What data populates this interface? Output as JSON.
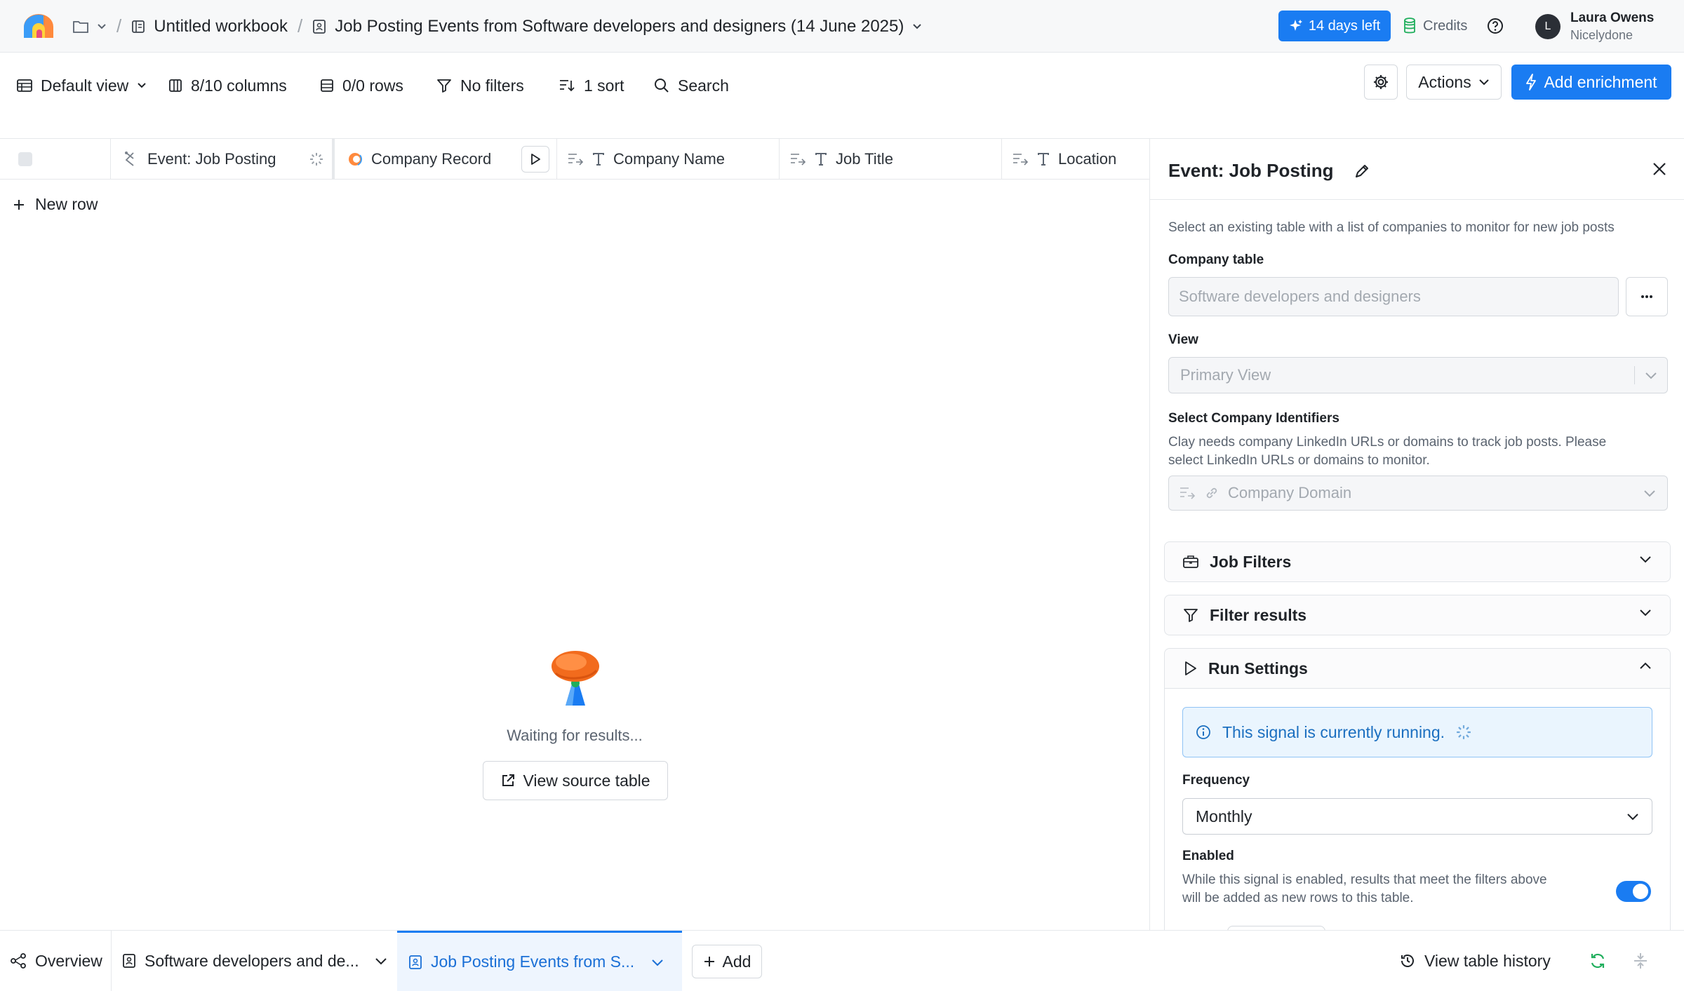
{
  "topbar": {
    "workbook": "Untitled workbook",
    "table_title": "Job Posting Events from Software developers and designers (14 June 2025)",
    "trial": "14 days left",
    "credits": "Credits",
    "user_name": "Laura Owens",
    "user_org": "Nicelydone",
    "avatar_initial": "L"
  },
  "toolbar": {
    "view": "Default view",
    "columns": "8/10 columns",
    "rows": "0/0 rows",
    "filters": "No filters",
    "sort": "1 sort",
    "search": "Search",
    "actions": "Actions",
    "add_enrichment": "Add enrichment"
  },
  "grid": {
    "columns": [
      "Event: Job Posting",
      "Company Record",
      "Company Name",
      "Job Title",
      "Location"
    ],
    "new_row": "New row",
    "waiting": "Waiting for results...",
    "view_source": "View source table"
  },
  "panel": {
    "title": "Event: Job Posting",
    "intro": "Select an existing table with a list of companies to monitor for new job posts",
    "company_table_label": "Company table",
    "company_table_value": "Software developers and designers",
    "view_label": "View",
    "view_value": "Primary View",
    "identifiers_label": "Select Company Identifiers",
    "identifiers_help_1": "Clay needs company LinkedIn URLs or domains to track job posts. Please",
    "identifiers_help_2": "select LinkedIn URLs or domains to monitor.",
    "identifiers_value": "Company Domain",
    "job_filters": "Job Filters",
    "filter_results": "Filter results",
    "run_settings": "Run Settings",
    "running_notice": "This signal is currently running.",
    "frequency_label": "Frequency",
    "frequency_value": "Monthly",
    "enabled_label": "Enabled",
    "enabled_help_1": "While this signal is enabled, results that meet the filters above",
    "enabled_help_2": "will be added as new rows to this table.",
    "enabled": true
  },
  "bottombar": {
    "overview": "Overview",
    "tab1": "Software developers and de...",
    "tab2": "Job Posting Events from S...",
    "add": "Add",
    "history": "View table history"
  },
  "colors": {
    "accent": "#1a7cf2",
    "sync": "#1fae5c"
  }
}
